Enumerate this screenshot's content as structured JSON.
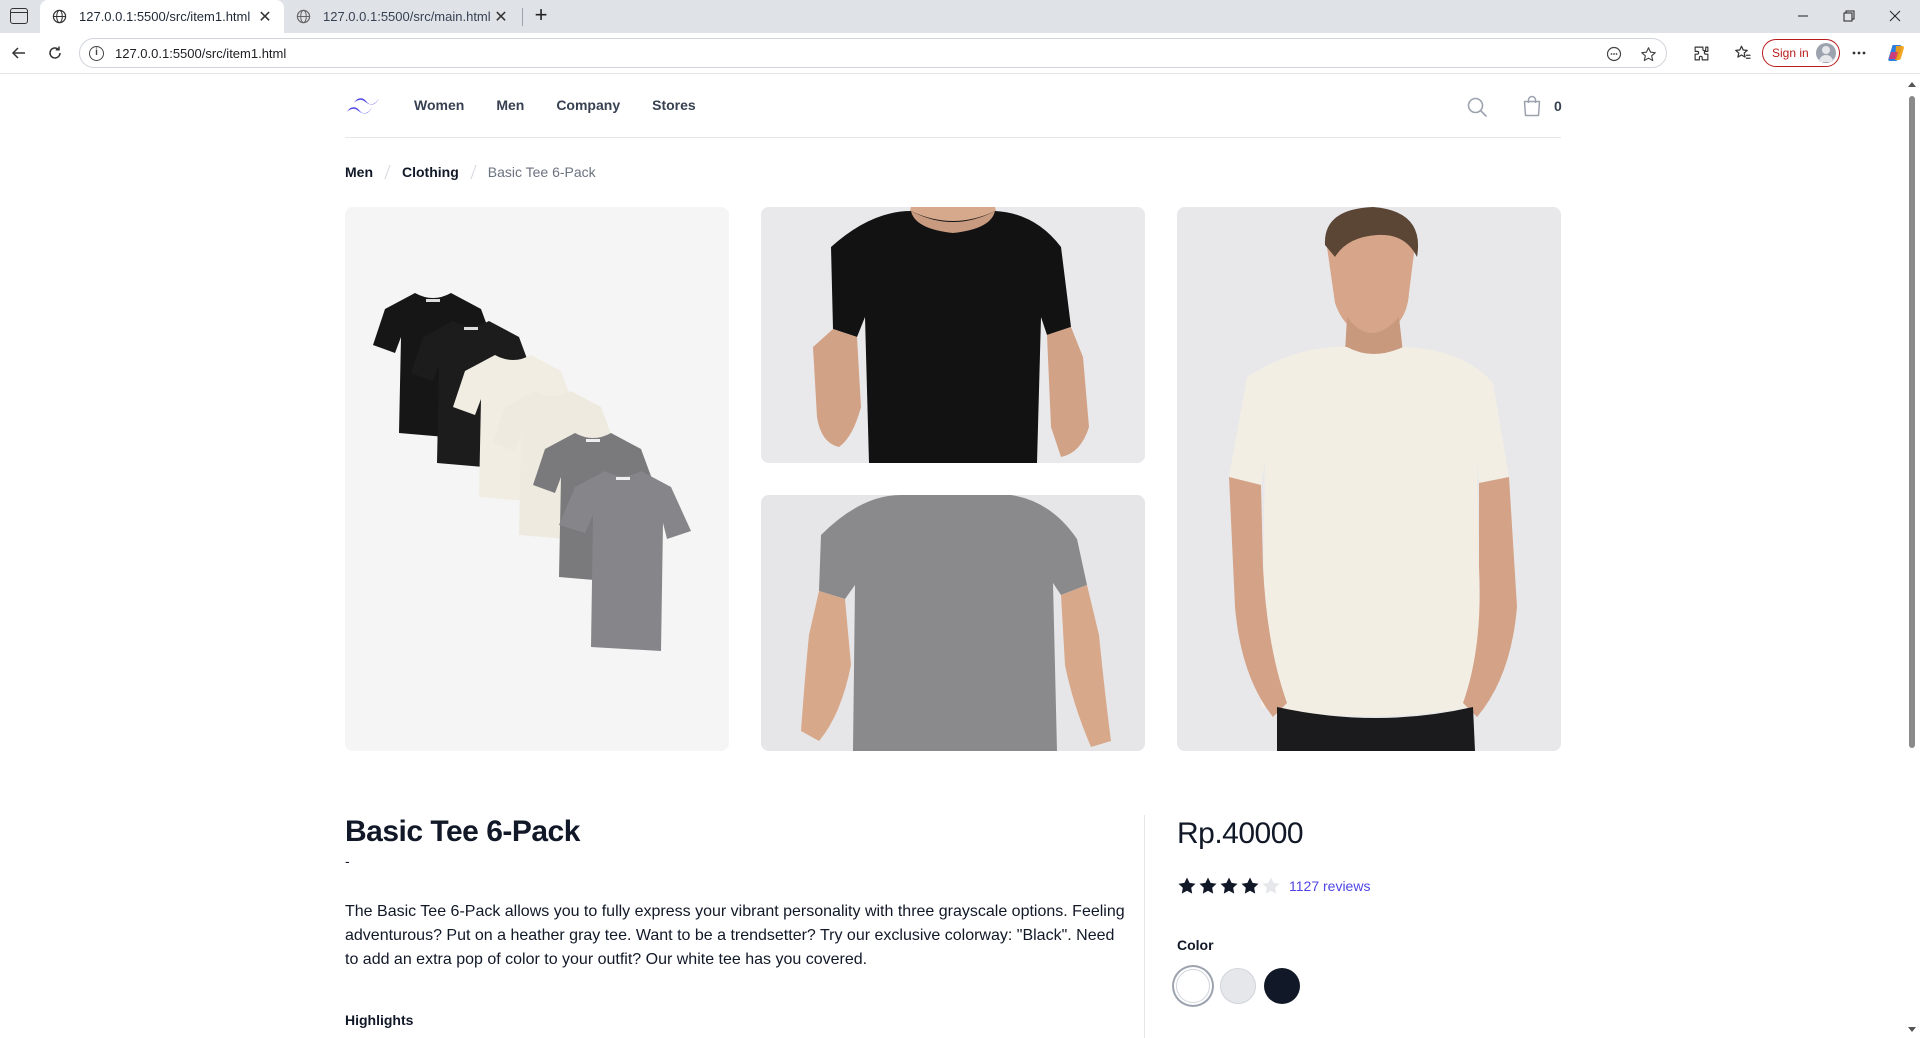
{
  "browser": {
    "tabs": [
      {
        "title": "127.0.0.1:5500/src/item1.html",
        "active": true
      },
      {
        "title": "127.0.0.1:5500/src/main.html",
        "active": false
      }
    ],
    "url": "127.0.0.1:5500/src/item1.html",
    "sign_in_label": "Sign in"
  },
  "site": {
    "brand_color": "#4f46e5",
    "menu": [
      "Women",
      "Men",
      "Company",
      "Stores"
    ],
    "cart_count": "0"
  },
  "breadcrumb": [
    "Men",
    "Clothing",
    "Basic Tee 6-Pack"
  ],
  "product": {
    "title": "Basic Tee 6-Pack",
    "subtitle": "-",
    "description": "The Basic Tee 6-Pack allows you to fully express your vibrant personality with three grayscale options. Feeling adventurous? Put on a heather gray tee. Want to be a trendsetter? Try our exclusive colorway: \"Black\". Need to add an extra pop of color to your outfit? Our white tee has you covered.",
    "highlights_label": "Highlights",
    "price": "Rp.40000",
    "rating": 4,
    "rating_max": 5,
    "reviews_label": "1127 reviews",
    "color_label": "Color",
    "colors": [
      {
        "name": "White",
        "hex": "#ffffff",
        "selected": true
      },
      {
        "name": "Gray",
        "hex": "#e5e7eb",
        "selected": false
      },
      {
        "name": "Black",
        "hex": "#111827",
        "selected": false
      }
    ]
  },
  "images": [
    {
      "name": "tees-stack"
    },
    {
      "name": "black-tee-model"
    },
    {
      "name": "gray-tee-model"
    },
    {
      "name": "white-tee-model"
    }
  ]
}
